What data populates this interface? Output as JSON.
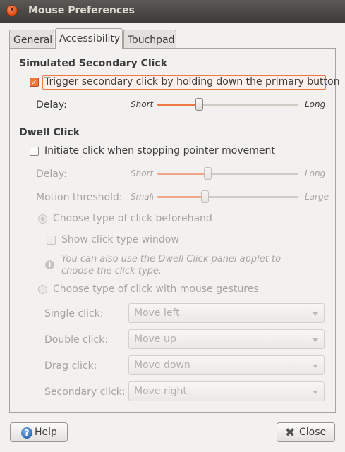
{
  "window": {
    "title": "Mouse Preferences",
    "close_glyph": "✕"
  },
  "tabs": [
    {
      "label": "General"
    },
    {
      "label": "Accessibility"
    },
    {
      "label": "Touchpad"
    }
  ],
  "secondary": {
    "heading": "Simulated Secondary Click",
    "checkbox_label": "Trigger secondary click by holding down the primary button",
    "checked": true,
    "delay_label": "Delay:",
    "short": "Short",
    "long": "Long",
    "delay_value": 0.3
  },
  "dwell": {
    "heading": "Dwell Click",
    "checkbox_label": "Initiate click when stopping pointer movement",
    "checked": false,
    "delay_label": "Delay:",
    "short": "Short",
    "long": "Long",
    "delay_value": 0.36,
    "motion_label": "Motion threshold:",
    "small": "Small",
    "large": "Large",
    "motion_value": 0.34,
    "radio_beforehand": "Choose type of click beforehand",
    "show_window": "Show click type window",
    "info_text_line1": "You can also use the Dwell Click panel applet to",
    "info_text_line2": "choose the click type.",
    "radio_gestures": "Choose type of click with mouse gestures",
    "gestures": [
      {
        "label": "Single click:",
        "value": "Move left"
      },
      {
        "label": "Double click:",
        "value": "Move up"
      },
      {
        "label": "Drag click:",
        "value": "Move down"
      },
      {
        "label": "Secondary click:",
        "value": "Move right"
      }
    ]
  },
  "buttons": {
    "help": "Help",
    "close": "Close"
  },
  "colors": {
    "accent": "#f07746",
    "titlebar": "#3c3b37"
  }
}
